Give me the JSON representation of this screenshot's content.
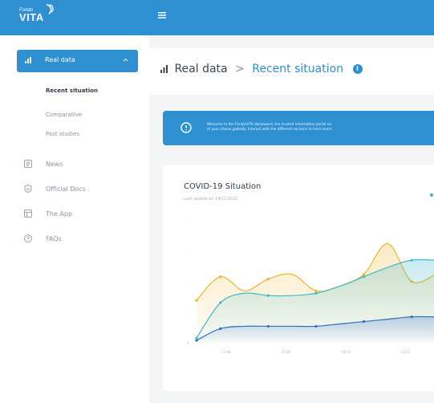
{
  "brand": {
    "small": "Fondo",
    "name": "VITA"
  },
  "sidebar": {
    "section_label": "Real data",
    "subitems": [
      "Recent situation",
      "Comparative",
      "Past studies"
    ],
    "items": [
      "News",
      "Official Docs",
      "The App",
      "FAQs"
    ]
  },
  "breadcrumb": {
    "parent": "Real data",
    "separator": ">",
    "current": "Recent situation",
    "info": "i"
  },
  "banner": {
    "line1": "Welcome to the FondoVITA dashboard, the trusted information portal on",
    "line2": "of your choice globally. Interact with the different sections to learn more."
  },
  "card": {
    "title": "COVID-19 Situation",
    "subtitle": "Last update on 14/11/2022"
  },
  "colors": {
    "accent": "#2e8fd1",
    "series_orange": "#f0b429",
    "series_teal": "#3cb8c8",
    "series_blue": "#2f6fc0"
  },
  "chart_data": {
    "type": "area",
    "x": [
      "",
      "11/08",
      "",
      "07/09",
      "",
      "14/10",
      "",
      "11/11",
      ""
    ],
    "y_ticks": [
      "0",
      "",
      "",
      "",
      ""
    ],
    "series": [
      {
        "values": [
          18,
          28,
          22,
          27,
          29,
          22,
          24,
          29,
          42,
          26,
          29
        ]
      },
      {
        "values": [
          2,
          17,
          21,
          20,
          20,
          21,
          24,
          28,
          32,
          35,
          35
        ]
      },
      {
        "values": [
          1,
          6,
          7,
          7,
          7,
          7,
          8,
          9,
          10,
          11,
          11
        ]
      }
    ],
    "ylim": [
      0,
      50
    ]
  }
}
